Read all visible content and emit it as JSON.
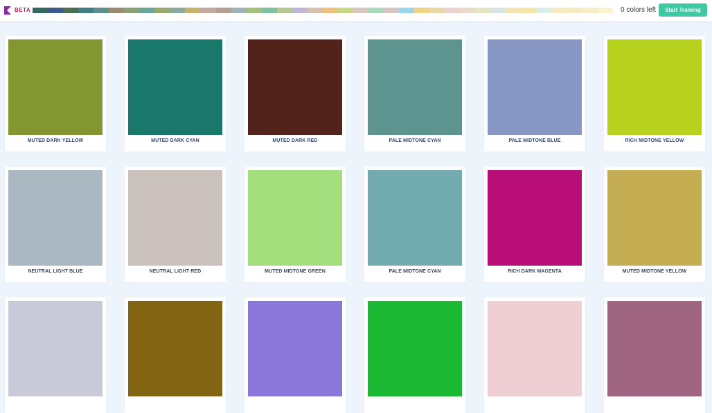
{
  "header": {
    "badge": "BETA",
    "colors_left_text": "0 colors left",
    "start_button": "Start Training",
    "logo_color": "#8e24aa",
    "strip": [
      "#2f6a5c",
      "#3d5b8a",
      "#4d6f4f",
      "#3f7f83",
      "#5e8f8a",
      "#9a8a6f",
      "#8d9f74",
      "#6ca69a",
      "#9aa76f",
      "#8aa9a0",
      "#c8b26c",
      "#c4a8a2",
      "#b79e8e",
      "#9eb4b7",
      "#a4c07a",
      "#7fc2a3",
      "#b5c792",
      "#c3b5d6",
      "#d4c0ad",
      "#edc27d",
      "#c8d88a",
      "#d9c8c2",
      "#a9dbb8",
      "#d8c5c1",
      "#9bd6ec",
      "#f1d385",
      "#e9d7a6",
      "#f0cfcf",
      "#ead8c8",
      "#e4e6c2",
      "#d7e4e4",
      "#f2e3b0",
      "#f3e4a8",
      "#d9efe9",
      "#f6ecbf",
      "#f7eac2",
      "#f5eec8",
      "#fbf3cd"
    ]
  },
  "cards": [
    {
      "label": "MUTED DARK YELLOW",
      "color": "#839631"
    },
    {
      "label": "MUTED DARK CYAN",
      "color": "#1a776b"
    },
    {
      "label": "MUTED DARK RED",
      "color": "#51231a"
    },
    {
      "label": "PALE MIDTONE CYAN",
      "color": "#5e948f"
    },
    {
      "label": "PALE MIDTONE BLUE",
      "color": "#8896c3"
    },
    {
      "label": "RICH MIDTONE YELLOW",
      "color": "#b6d21e"
    },
    {
      "label": "NEUTRAL LIGHT BLUE",
      "color": "#abb8c2"
    },
    {
      "label": "NEUTRAL LIGHT RED",
      "color": "#cbc1bc"
    },
    {
      "label": "MUTED MIDTONE GREEN",
      "color": "#a2df7c"
    },
    {
      "label": "PALE MIDTONE CYAN",
      "color": "#72acb0"
    },
    {
      "label": "RICH DARK MAGENTA",
      "color": "#b90e78"
    },
    {
      "label": "MUTED MIDTONE YELLOW",
      "color": "#c4ad52"
    },
    {
      "label": "",
      "color": "#c9cad8"
    },
    {
      "label": "",
      "color": "#836412"
    },
    {
      "label": "",
      "color": "#8978da"
    },
    {
      "label": "",
      "color": "#1bb833"
    },
    {
      "label": "",
      "color": "#efcfd3"
    },
    {
      "label": "",
      "color": "#9f6580"
    }
  ]
}
